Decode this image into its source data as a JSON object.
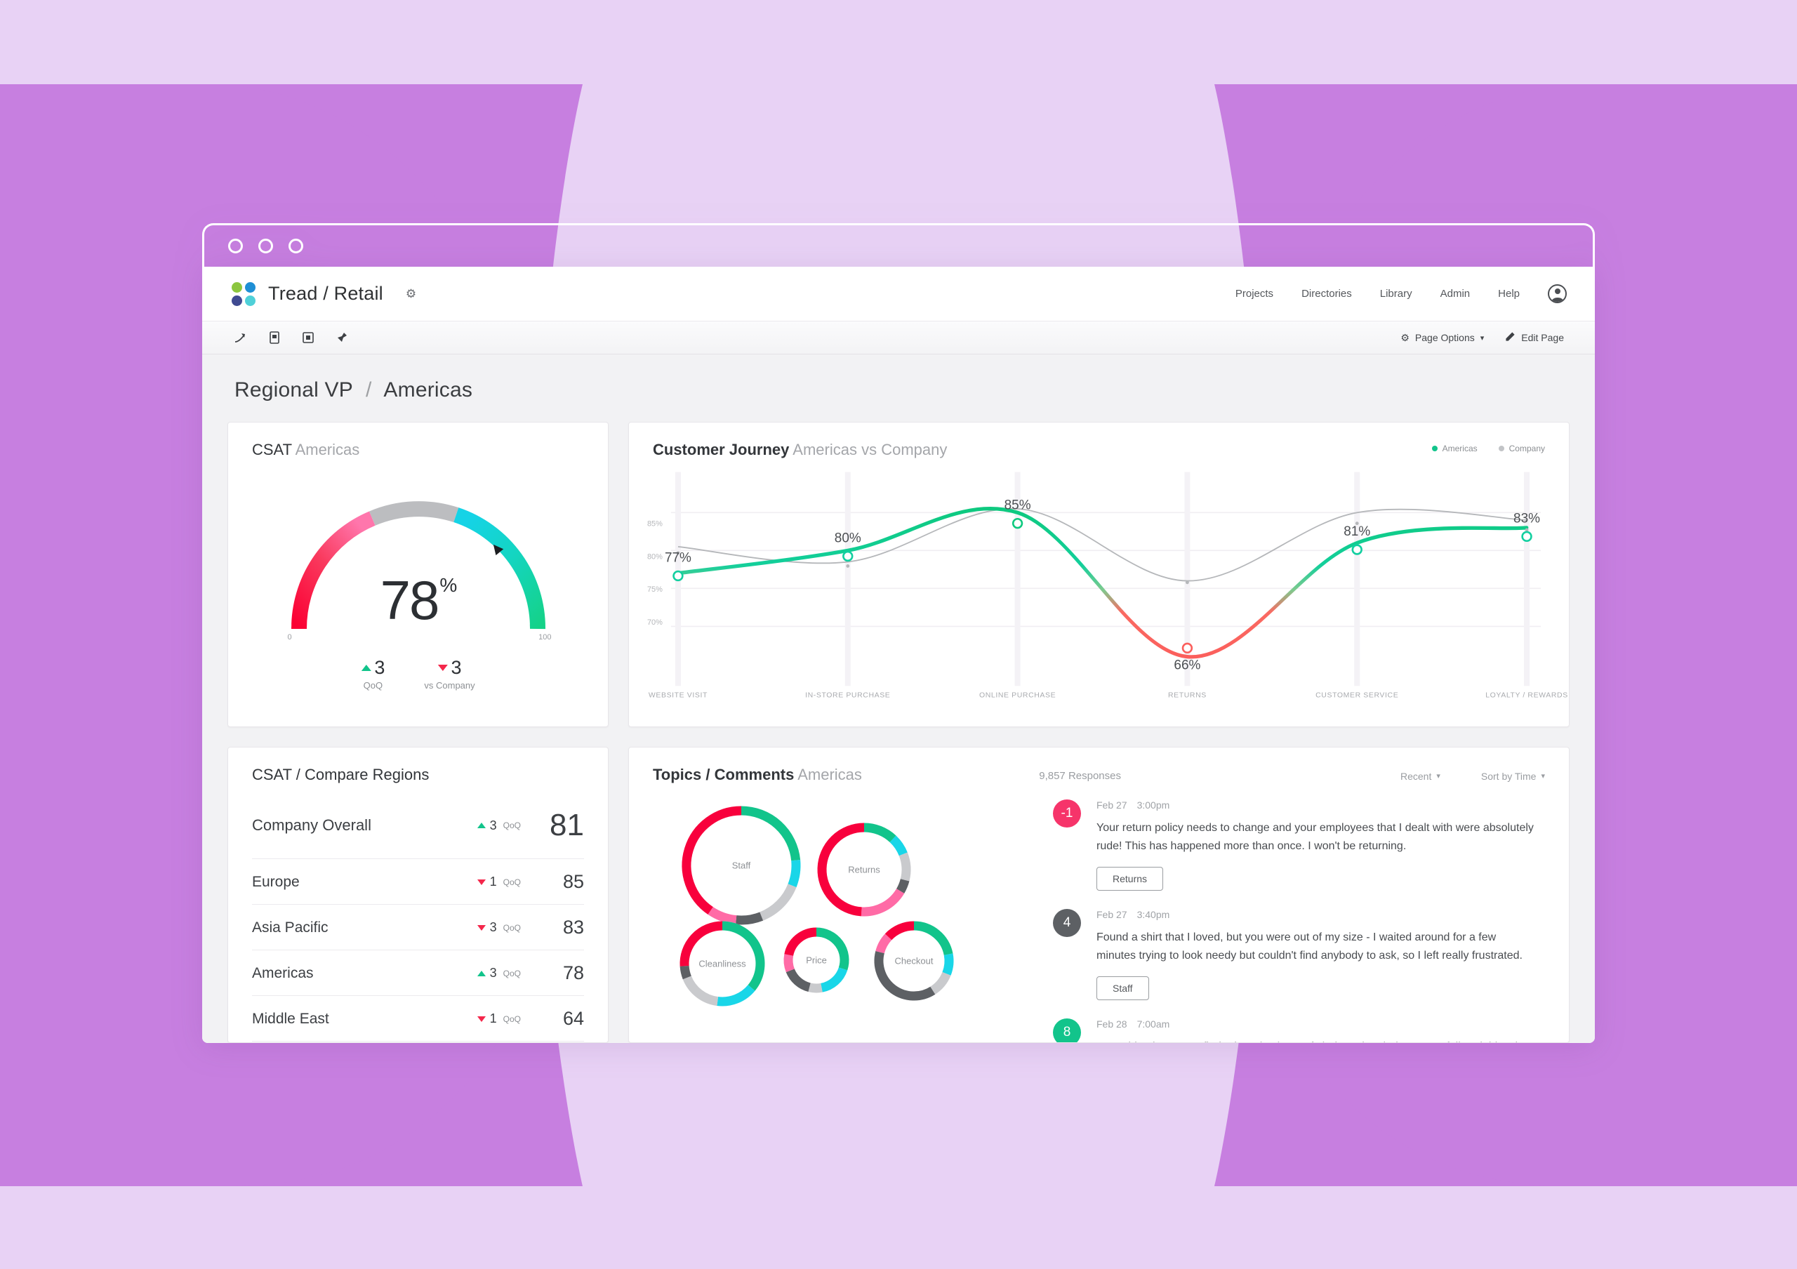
{
  "window": {
    "dots": [
      "close",
      "minimize",
      "maximize"
    ]
  },
  "header": {
    "brand_title": "Tread / Retail",
    "gear_icon": "gear-icon",
    "logo_colors": [
      "#8cc63f",
      "#1e8fd5",
      "#3f4a91",
      "#4fd0d8"
    ],
    "nav": [
      {
        "label": "Projects"
      },
      {
        "label": "Directories"
      },
      {
        "label": "Library"
      },
      {
        "label": "Admin"
      },
      {
        "label": "Help"
      }
    ],
    "avatar": "user-avatar-icon"
  },
  "toolbar": {
    "icons": [
      "share-arrow-icon",
      "document-icon",
      "dashboard-icon",
      "pin-icon"
    ],
    "page_options_label": "Page Options",
    "edit_page_label": "Edit Page"
  },
  "breadcrumb": {
    "root": "Regional VP",
    "separator": "/",
    "current": "Americas"
  },
  "csat_gauge": {
    "title": "CSAT",
    "subtitle": "Americas",
    "value": "78",
    "unit": "%",
    "min_label": "0",
    "max_label": "100",
    "deltas": [
      {
        "direction": "up",
        "value": "3",
        "label": "QoQ"
      },
      {
        "direction": "down",
        "value": "3",
        "label": "vs Company"
      }
    ],
    "colors": {
      "red": "#f8003c",
      "pink": "#ff6ba6",
      "grey": "#b9babd",
      "cyan": "#19d6e8",
      "green": "#19d392"
    }
  },
  "journey": {
    "title": "Customer Journey",
    "subtitle": "Americas vs Company",
    "legend": [
      {
        "label": "Americas",
        "color": "#12c48b"
      },
      {
        "label": "Company",
        "color": "#b5b7ba"
      }
    ]
  },
  "compare_regions": {
    "title_main": "CSAT",
    "title_sep": "/",
    "title_sub": "Compare Regions",
    "overall": {
      "name": "Company Overall",
      "direction": "up",
      "delta": "3",
      "delta_label": "QoQ",
      "score": "81"
    },
    "rows": [
      {
        "name": "Europe",
        "direction": "down",
        "delta": "1",
        "delta_label": "QoQ",
        "score": "85"
      },
      {
        "name": "Asia Pacific",
        "direction": "down",
        "delta": "3",
        "delta_label": "QoQ",
        "score": "83"
      },
      {
        "name": "Americas",
        "direction": "up",
        "delta": "3",
        "delta_label": "QoQ",
        "score": "78"
      },
      {
        "name": "Middle East",
        "direction": "down",
        "delta": "1",
        "delta_label": "QoQ",
        "score": "64"
      }
    ]
  },
  "topics": {
    "title_main": "Topics",
    "title_sep": "/",
    "title_second": "Comments",
    "subtitle": "Americas",
    "responses": "9,857 Responses",
    "filter_recent": "Recent",
    "sort_by": "Sort by Time",
    "bubbles": [
      {
        "label": "Staff"
      },
      {
        "label": "Returns"
      },
      {
        "label": "Cleanliness"
      },
      {
        "label": "Price"
      },
      {
        "label": "Checkout"
      }
    ],
    "comments": [
      {
        "score": "-1",
        "score_color": "#f6346a",
        "date": "Feb 27",
        "time": "3:00pm",
        "text": "Your return policy needs to change and your employees that I dealt with were absolutely rude!  This has happened more than once.  I won't be returning.",
        "tag": "Returns"
      },
      {
        "score": "4",
        "score_color": "#5d6064",
        "date": "Feb 27",
        "time": "3:40pm",
        "text": "Found a shirt that I loved, but you were out of my size - I waited around for a few minutes trying to look needy but couldn't find anybody to ask, so I left really frustrated.",
        "tag": "Staff"
      },
      {
        "score": "8",
        "score_color": "#12c48b",
        "date": "Feb 28",
        "time": "7:00am",
        "text": "Everything is easy to find. There is plenty of choice. The shelves were full and tidy. The aisles were",
        "tag": ""
      }
    ]
  },
  "chart_data": [
    {
      "type": "line",
      "title": "Customer Journey",
      "subtitle": "Americas vs Company",
      "xlabel": "",
      "ylabel": "",
      "categories": [
        "WEBSITE VISIT",
        "IN-STORE PURCHASE",
        "ONLINE PURCHASE",
        "RETURNS",
        "CUSTOMER SERVICE",
        "LOYALTY / REWARDS"
      ],
      "yticks": [
        "70%",
        "75%",
        "80%",
        "85%"
      ],
      "ylim": [
        63,
        88
      ],
      "grid": true,
      "legend_position": "top-right",
      "series": [
        {
          "name": "Americas",
          "color": "#12c48b",
          "values": [
            77,
            80,
            85,
            66,
            81,
            83
          ],
          "labels": [
            "77%",
            "80%",
            "85%",
            "66%",
            "81%",
            "83%"
          ]
        },
        {
          "name": "Company",
          "color": "#b5b7ba",
          "values": [
            80.5,
            78.5,
            85.5,
            76,
            85,
            84
          ],
          "labels": []
        }
      ]
    },
    {
      "type": "pie",
      "title": "CSAT Americas gauge",
      "gauge_value": 78,
      "gauge_min": 0,
      "gauge_max": 100,
      "segments": [
        {
          "name": "low",
          "fraction": 0.4,
          "color": "#f8003c"
        },
        {
          "name": "middle",
          "fraction": 0.18,
          "color": "#b9babd"
        },
        {
          "name": "high",
          "fraction": 0.42,
          "color": "#19d392"
        }
      ]
    },
    {
      "type": "pie",
      "title": "Topics donuts",
      "donuts": [
        {
          "name": "Staff",
          "radius": 78,
          "segments": [
            {
              "color": "#12c48b",
              "fraction": 0.235
            },
            {
              "color": "#19d6e8",
              "fraction": 0.075
            },
            {
              "color": "#c9cacd",
              "fraction": 0.13
            },
            {
              "color": "#5d6064",
              "fraction": 0.075
            },
            {
              "color": "#ff6ba6",
              "fraction": 0.08
            },
            {
              "color": "#f8003c",
              "fraction": 0.405
            }
          ]
        },
        {
          "name": "Returns",
          "radius": 60,
          "segments": [
            {
              "color": "#12c48b",
              "fraction": 0.12
            },
            {
              "color": "#19d6e8",
              "fraction": 0.07
            },
            {
              "color": "#c9cacd",
              "fraction": 0.1
            },
            {
              "color": "#5d6064",
              "fraction": 0.045
            },
            {
              "color": "#ff6ba6",
              "fraction": 0.175
            },
            {
              "color": "#f8003c",
              "fraction": 0.49
            }
          ]
        },
        {
          "name": "Cleanliness",
          "radius": 54,
          "segments": [
            {
              "color": "#12c48b",
              "fraction": 0.36
            },
            {
              "color": "#19d6e8",
              "fraction": 0.16
            },
            {
              "color": "#c9cacd",
              "fraction": 0.17
            },
            {
              "color": "#5d6064",
              "fraction": 0.05
            },
            {
              "color": "#f8003c",
              "fraction": 0.26
            }
          ]
        },
        {
          "name": "Price",
          "radius": 40,
          "segments": [
            {
              "color": "#12c48b",
              "fraction": 0.3
            },
            {
              "color": "#19d6e8",
              "fraction": 0.17
            },
            {
              "color": "#c9cacd",
              "fraction": 0.07
            },
            {
              "color": "#5d6064",
              "fraction": 0.15
            },
            {
              "color": "#ff6ba6",
              "fraction": 0.09
            },
            {
              "color": "#f8003c",
              "fraction": 0.22
            }
          ]
        },
        {
          "name": "Checkout",
          "radius": 50,
          "segments": [
            {
              "color": "#12c48b",
              "fraction": 0.22
            },
            {
              "color": "#19d6e8",
              "fraction": 0.09
            },
            {
              "color": "#c9cacd",
              "fraction": 0.1
            },
            {
              "color": "#5d6064",
              "fraction": 0.38
            },
            {
              "color": "#ff6ba6",
              "fraction": 0.08
            },
            {
              "color": "#f8003c",
              "fraction": 0.13
            }
          ]
        }
      ]
    }
  ]
}
